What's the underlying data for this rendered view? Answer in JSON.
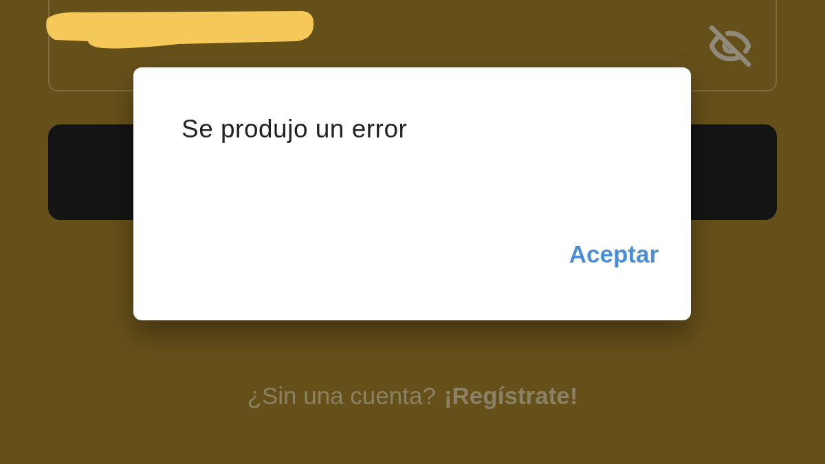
{
  "dialog": {
    "title": "Se produjo un error",
    "button": "Aceptar"
  },
  "signup_prompt": {
    "text": "¿Sin una cuenta?",
    "link": "¡Regístrate!"
  }
}
